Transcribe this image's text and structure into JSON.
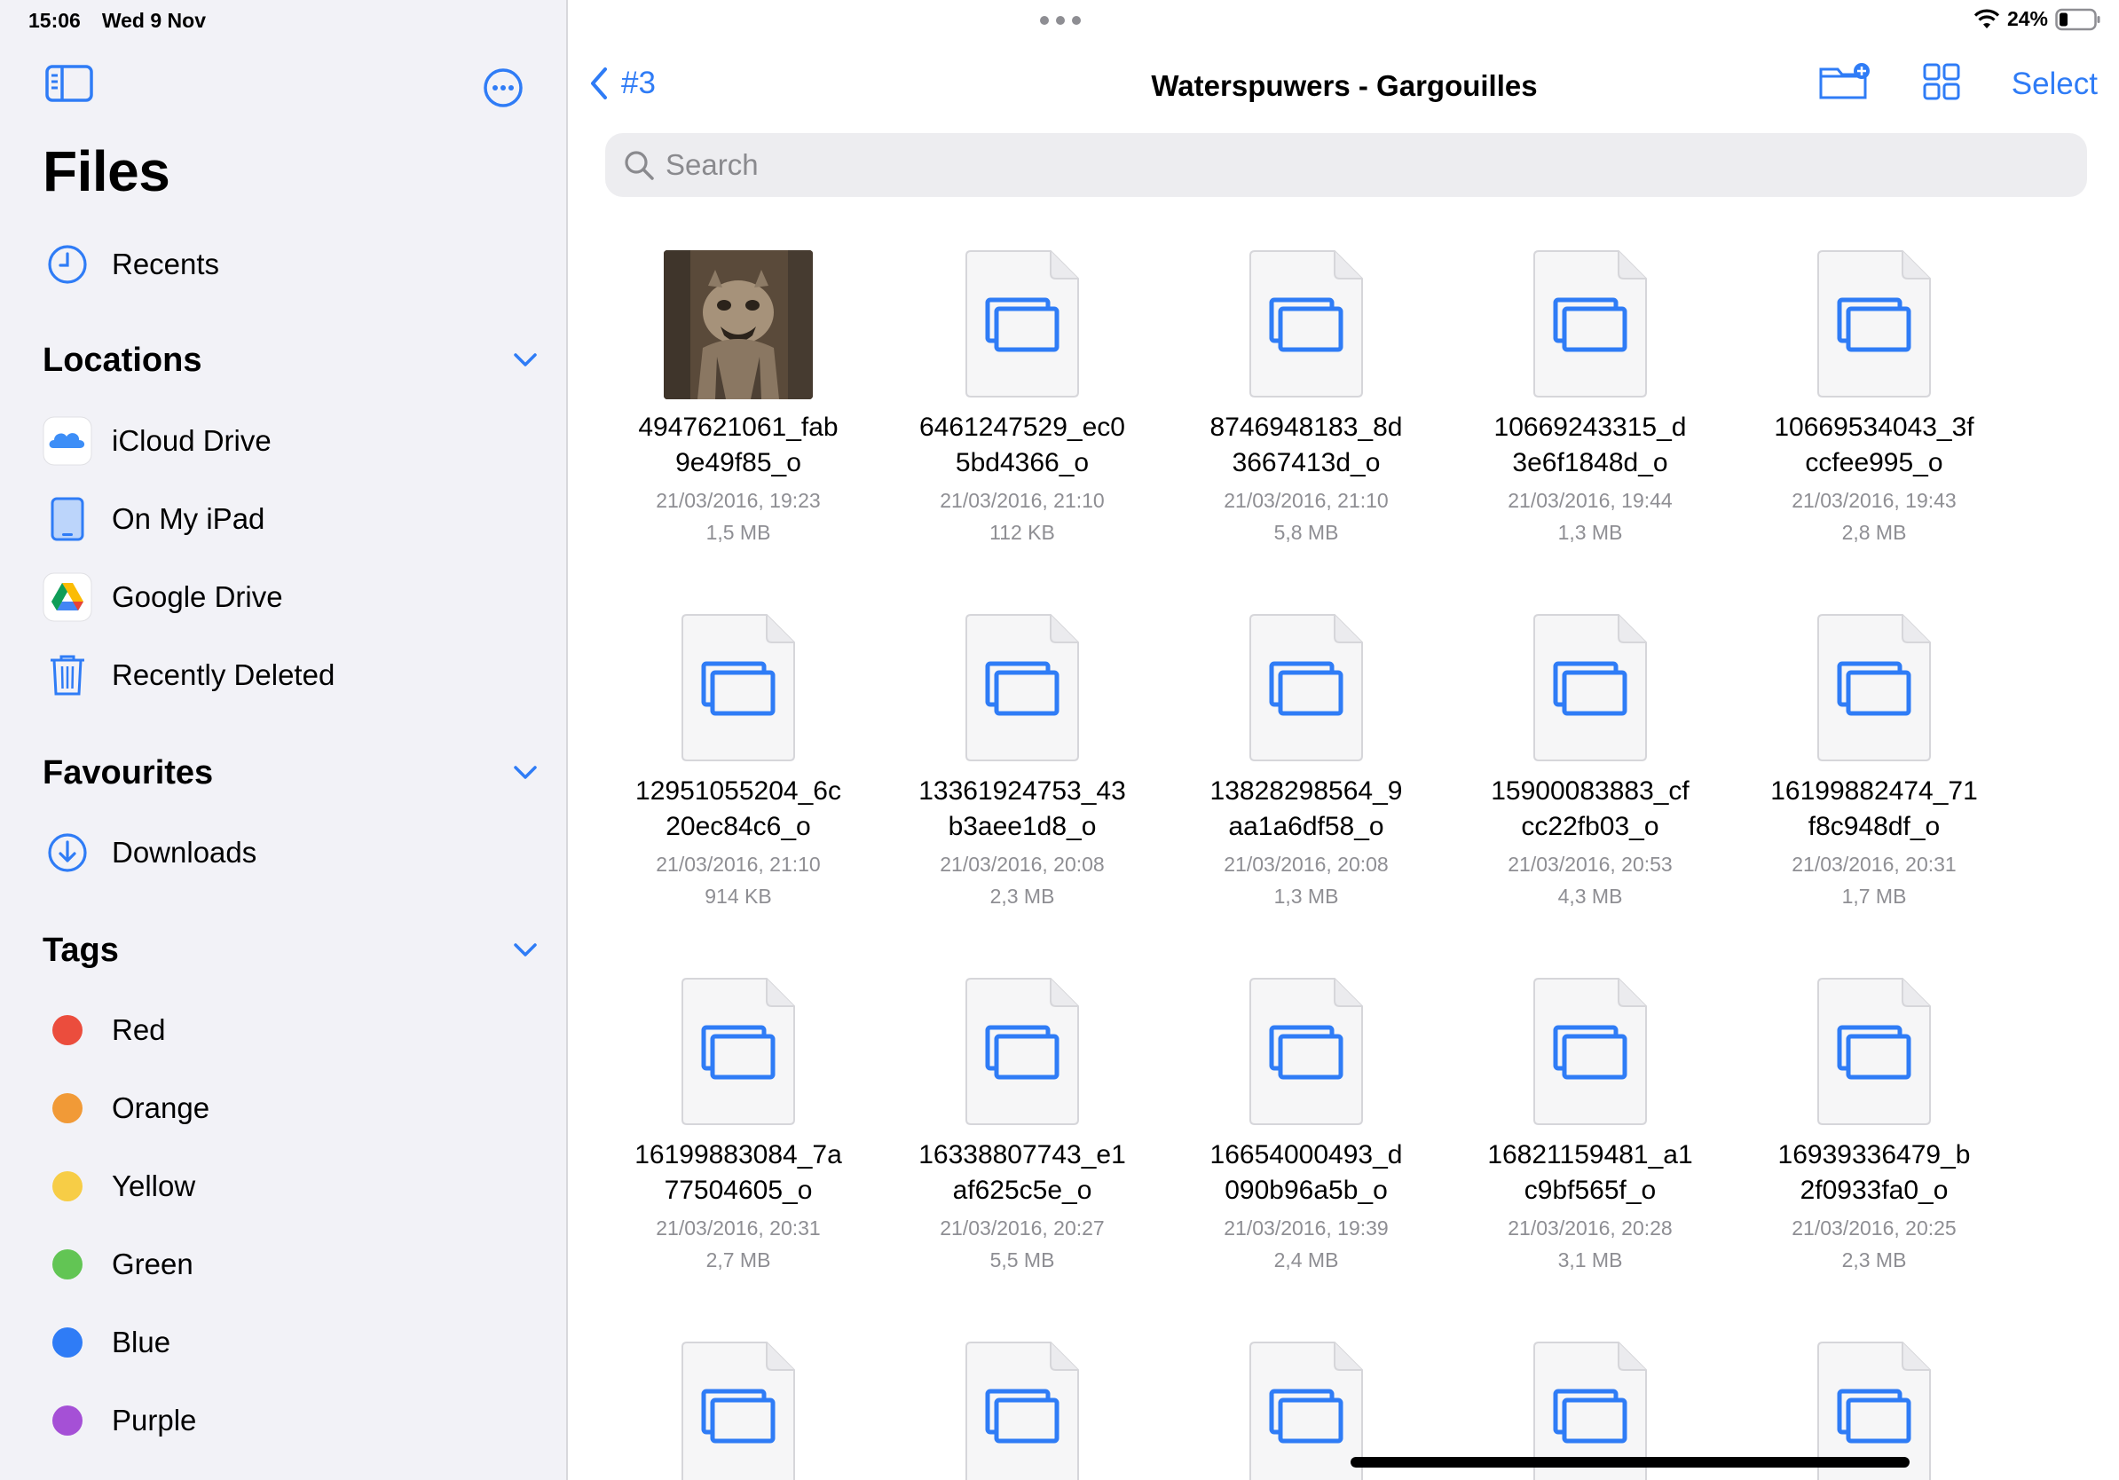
{
  "status_bar": {
    "time": "15:06",
    "date": "Wed 9 Nov",
    "battery": "24%"
  },
  "sidebar": {
    "title": "Files",
    "recents": "Recents",
    "locations_header": "Locations",
    "locations": [
      {
        "label": "iCloud Drive",
        "icon": "icloud-icon"
      },
      {
        "label": "On My iPad",
        "icon": "ipad-icon"
      },
      {
        "label": "Google Drive",
        "icon": "google-drive-icon"
      },
      {
        "label": "Recently Deleted",
        "icon": "trash-icon"
      }
    ],
    "favourites_header": "Favourites",
    "favourites": [
      {
        "label": "Downloads",
        "icon": "download-icon"
      }
    ],
    "tags_header": "Tags",
    "tags": [
      {
        "label": "Red",
        "color": "#eb4d3d"
      },
      {
        "label": "Orange",
        "color": "#f19a37"
      },
      {
        "label": "Yellow",
        "color": "#f7cd46"
      },
      {
        "label": "Green",
        "color": "#62c554"
      },
      {
        "label": "Blue",
        "color": "#2f7cf6"
      },
      {
        "label": "Purple",
        "color": "#a550d6"
      }
    ]
  },
  "nav": {
    "back_label": "#3",
    "title": "Waterspuwers - Gargouilles",
    "select_label": "Select"
  },
  "search": {
    "placeholder": "Search"
  },
  "files": [
    {
      "name_line1": "4947621061_fab",
      "name_line2": "9e49f85_o",
      "date": "21/03/2016, 19:23",
      "size": "1,5 MB",
      "thumb": "photo"
    },
    {
      "name_line1": "6461247529_ec0",
      "name_line2": "5bd4366_o",
      "date": "21/03/2016, 21:10",
      "size": "112 KB",
      "thumb": "file"
    },
    {
      "name_line1": "8746948183_8d",
      "name_line2": "3667413d_o",
      "date": "21/03/2016, 21:10",
      "size": "5,8 MB",
      "thumb": "file"
    },
    {
      "name_line1": "10669243315_d",
      "name_line2": "3e6f1848d_o",
      "date": "21/03/2016, 19:44",
      "size": "1,3 MB",
      "thumb": "file"
    },
    {
      "name_line1": "10669534043_3f",
      "name_line2": "ccfee995_o",
      "date": "21/03/2016, 19:43",
      "size": "2,8 MB",
      "thumb": "file"
    },
    {
      "name_line1": "12951055204_6c",
      "name_line2": "20ec84c6_o",
      "date": "21/03/2016, 21:10",
      "size": "914 KB",
      "thumb": "file"
    },
    {
      "name_line1": "13361924753_43",
      "name_line2": "b3aee1d8_o",
      "date": "21/03/2016, 20:08",
      "size": "2,3 MB",
      "thumb": "file"
    },
    {
      "name_line1": "13828298564_9",
      "name_line2": "aa1a6df58_o",
      "date": "21/03/2016, 20:08",
      "size": "1,3 MB",
      "thumb": "file"
    },
    {
      "name_line1": "15900083883_cf",
      "name_line2": "cc22fb03_o",
      "date": "21/03/2016, 20:53",
      "size": "4,3 MB",
      "thumb": "file"
    },
    {
      "name_line1": "16199882474_71",
      "name_line2": "f8c948df_o",
      "date": "21/03/2016, 20:31",
      "size": "1,7 MB",
      "thumb": "file"
    },
    {
      "name_line1": "16199883084_7a",
      "name_line2": "77504605_o",
      "date": "21/03/2016, 20:31",
      "size": "2,7 MB",
      "thumb": "file"
    },
    {
      "name_line1": "16338807743_e1",
      "name_line2": "af625c5e_o",
      "date": "21/03/2016, 20:27",
      "size": "5,5 MB",
      "thumb": "file"
    },
    {
      "name_line1": "16654000493_d",
      "name_line2": "090b96a5b_o",
      "date": "21/03/2016, 19:39",
      "size": "2,4 MB",
      "thumb": "file"
    },
    {
      "name_line1": "16821159481_a1",
      "name_line2": "c9bf565f_o",
      "date": "21/03/2016, 20:28",
      "size": "3,1 MB",
      "thumb": "file"
    },
    {
      "name_line1": "16939336479_b",
      "name_line2": "2f0933fa0_o",
      "date": "21/03/2016, 20:25",
      "size": "2,3 MB",
      "thumb": "file"
    },
    {
      "name_line1": "",
      "name_line2": "",
      "date": "",
      "size": "",
      "thumb": "file"
    },
    {
      "name_line1": "",
      "name_line2": "",
      "date": "",
      "size": "",
      "thumb": "file"
    },
    {
      "name_line1": "",
      "name_line2": "",
      "date": "",
      "size": "",
      "thumb": "file"
    },
    {
      "name_line1": "",
      "name_line2": "",
      "date": "",
      "size": "",
      "thumb": "file"
    },
    {
      "name_line1": "",
      "name_line2": "",
      "date": "",
      "size": "",
      "thumb": "file"
    }
  ],
  "colors": {
    "accent": "#2f7cf6",
    "sidebar_bg": "#f2f2f7",
    "secondary_text": "#8e8e93"
  }
}
